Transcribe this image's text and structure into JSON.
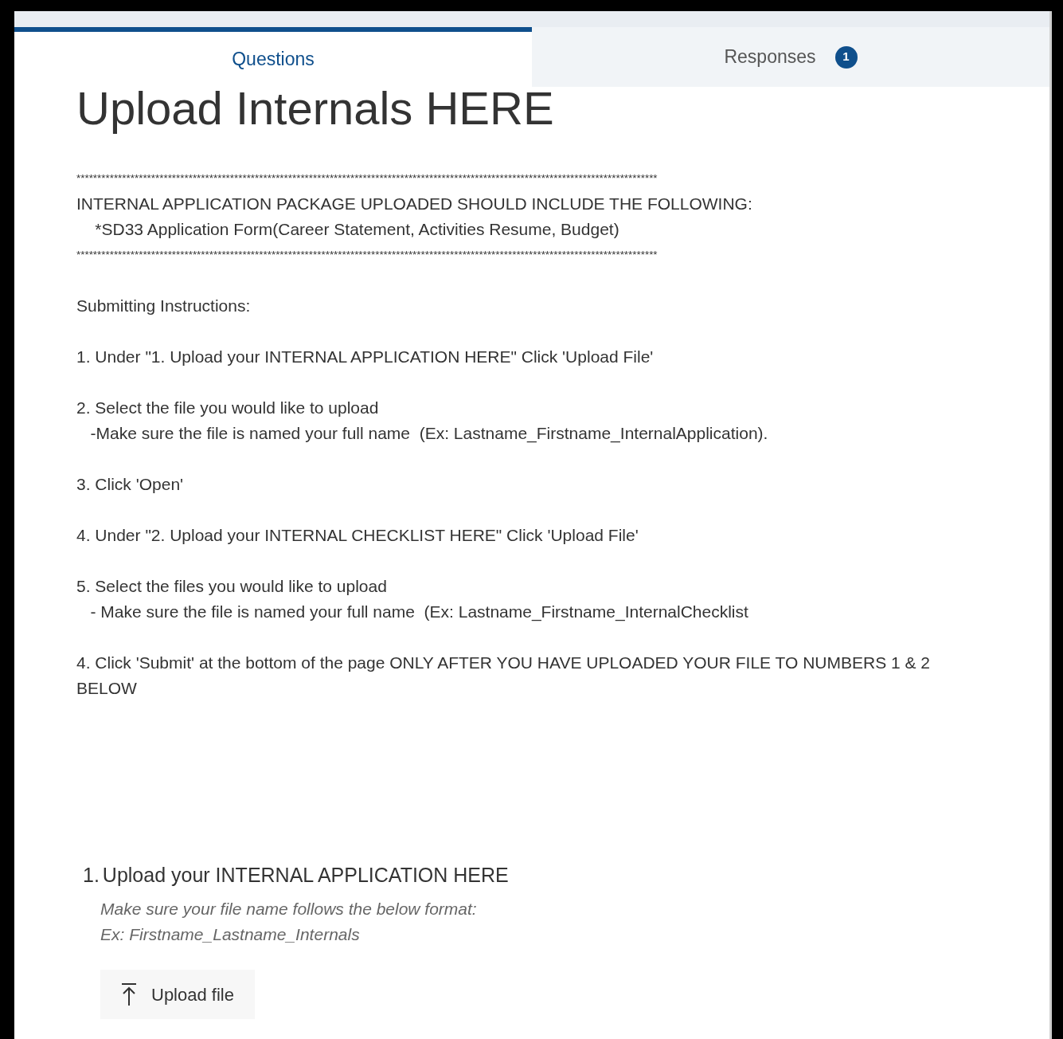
{
  "tabs": [
    {
      "label": "Questions",
      "selected": true
    },
    {
      "label": "Responses",
      "selected": false,
      "badge": "1"
    }
  ],
  "form_title": "Upload Internals HERE",
  "description": [
    [
      "********************************************************************************************************************************************",
      "INTERNAL APPLICATION PACKAGE UPLOADED SHOULD INCLUDE THE FOLLOWING:",
      "    *SD33 Application Form(Career Statement, Activities Resume, Budget)",
      "********************************************************************************************************************************************"
    ],
    [
      "Submitting Instructions:"
    ],
    [
      "1. Under \"1. Upload your INTERNAL APPLICATION HERE\" Click 'Upload File'"
    ],
    [
      "2. Select the file you would like to upload",
      "   -Make sure the file is named your full name  (Ex: Lastname_Firstname_InternalApplication)."
    ],
    [
      "3. Click 'Open'"
    ],
    [
      "4. Under \"2. Upload your INTERNAL CHECKLIST HERE\" Click 'Upload File'"
    ],
    [
      "5. Select the files you would like to upload",
      "   - Make sure the file is named your full name  (Ex: Lastname_Firstname_InternalChecklist"
    ],
    [
      "4. Click 'Submit' at the bottom of the page ONLY AFTER YOU HAVE UPLOADED YOUR FILE TO NUMBERS 1 & 2 BELOW"
    ]
  ],
  "questions": [
    {
      "number": "1.",
      "title": "Upload your INTERNAL APPLICATION HERE",
      "subtitle": [
        "Make sure your file name follows the below format:",
        "Ex: Firstname_Lastname_Internals"
      ],
      "button": "Upload file"
    }
  ]
}
